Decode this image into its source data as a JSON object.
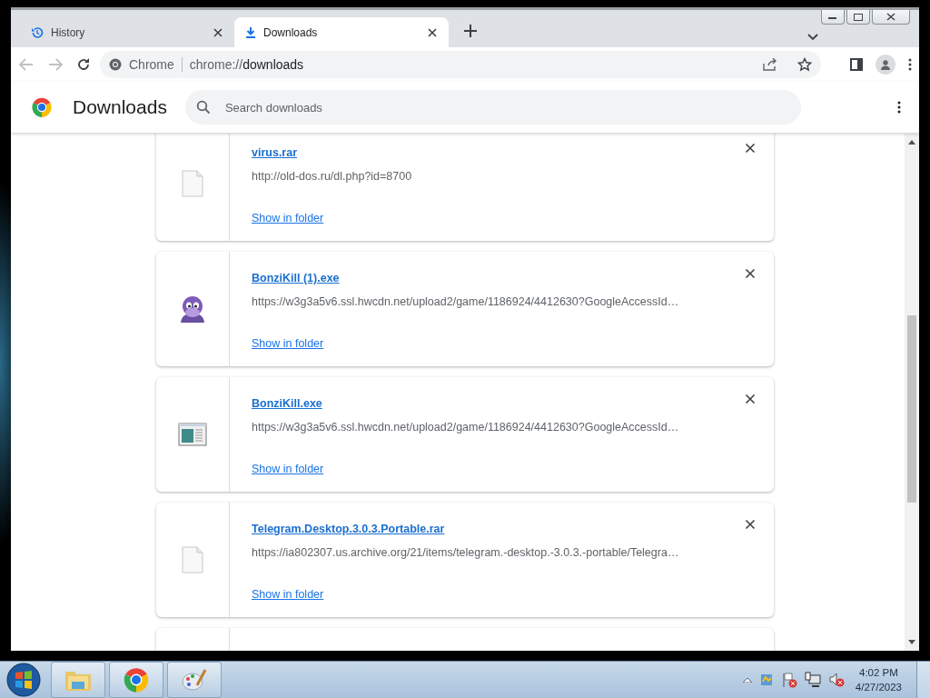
{
  "tabs": [
    {
      "label": "History",
      "kind": "history",
      "selected": false
    },
    {
      "label": "Downloads",
      "kind": "download",
      "selected": true
    }
  ],
  "address_bar": {
    "site_label": "Chrome",
    "url_scheme": "chrome://",
    "url_path": "downloads"
  },
  "page_header": {
    "title": "Downloads",
    "search": {
      "placeholder": "Search downloads"
    }
  },
  "downloads": [
    {
      "file_name": "virus.rar",
      "url": "http://old-dos.ru/dl.php?id=8700",
      "action": "Show in folder",
      "kind": "file"
    },
    {
      "file_name": "BonziKill (1).exe",
      "url": "https://w3g3a5v6.ssl.hwcdn.net/upload2/game/1186924/4412630?GoogleAccessId…",
      "action": "Show in folder",
      "kind": "character"
    },
    {
      "file_name": "BonziKill.exe",
      "url": "https://w3g3a5v6.ssl.hwcdn.net/upload2/game/1186924/4412630?GoogleAccessId…",
      "action": "Show in folder",
      "kind": "window"
    },
    {
      "file_name": "Telegram.Desktop.3.0.3.Portable.rar",
      "url": "https://ia802307.us.archive.org/21/items/telegram.-desktop.-3.0.3.-portable/Telegra…",
      "action": "Show in folder",
      "kind": "file"
    }
  ],
  "taskbar": {
    "clock": {
      "time": "4:02 PM",
      "date": "4/27/2023"
    }
  }
}
